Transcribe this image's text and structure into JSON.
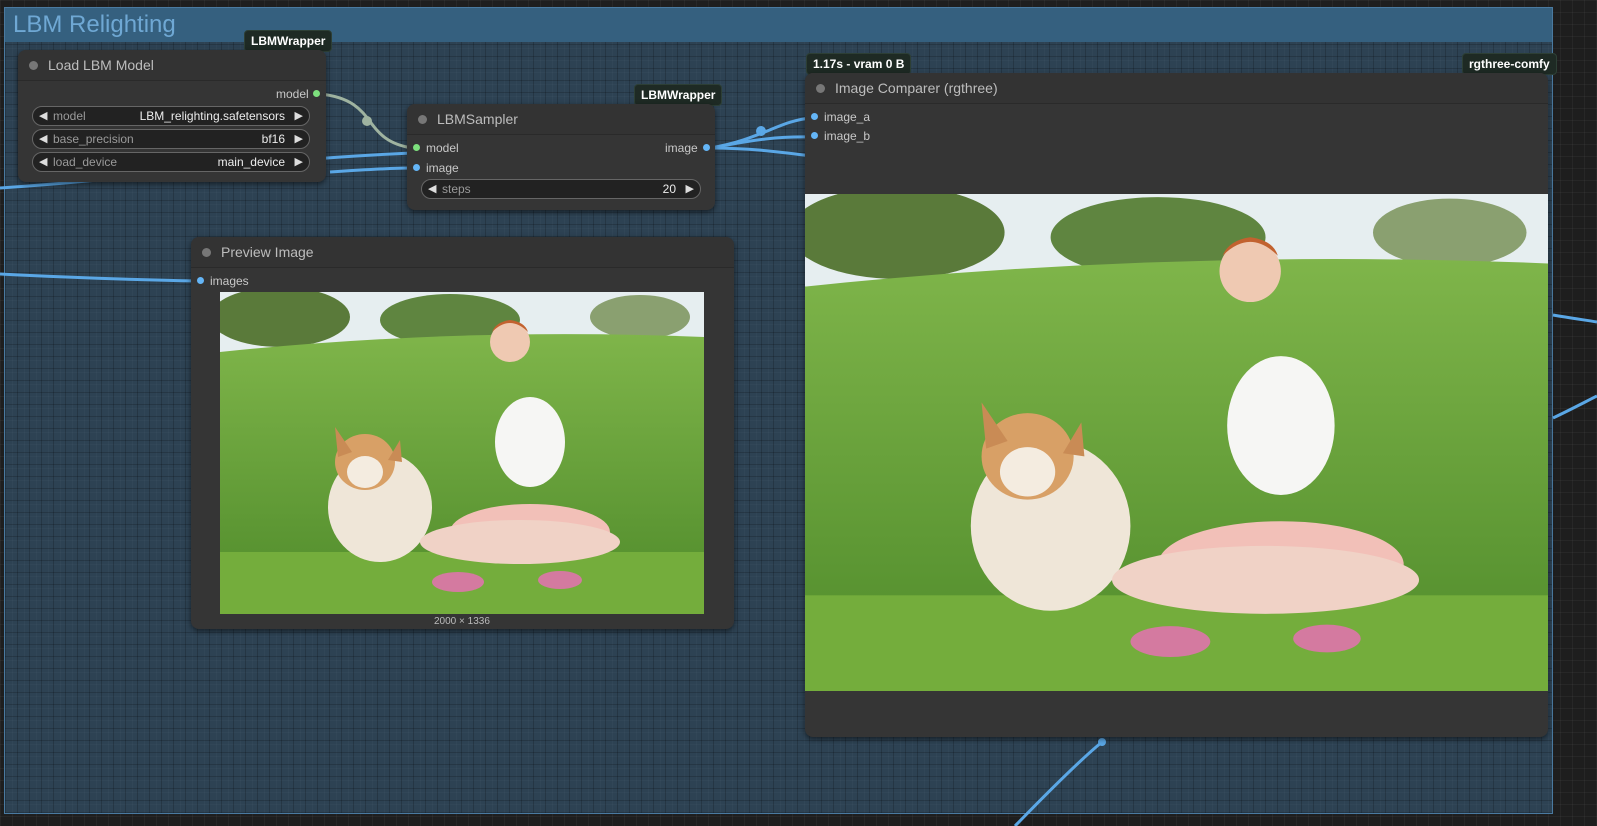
{
  "group": {
    "title": "LBM Relighting"
  },
  "badges": {
    "load_lbm": "LBMWrapper",
    "sampler": "LBMWrapper",
    "timing": "1.17s - vram 0 B",
    "comparer": "rgthree-comfy"
  },
  "load_lbm_node": {
    "title": "Load LBM Model",
    "output_label": "model",
    "widgets": [
      {
        "name": "model",
        "value": "LBM_relighting.safetensors"
      },
      {
        "name": "base_precision",
        "value": "bf16"
      },
      {
        "name": "load_device",
        "value": "main_device"
      }
    ]
  },
  "sampler_node": {
    "title": "LBMSampler",
    "inputs": [
      "model",
      "image"
    ],
    "output_label": "image",
    "widget": {
      "name": "steps",
      "value": "20"
    }
  },
  "preview_node": {
    "title": "Preview Image",
    "input_label": "images",
    "caption": "2000 × 1336"
  },
  "comparer_node": {
    "title": "Image Comparer (rgthree)",
    "inputs": [
      "image_a",
      "image_b"
    ]
  },
  "colors": {
    "model_socket": "#7de07d",
    "image_socket": "#64b5f6",
    "wire_image": "#5aa7e6",
    "wire_model": "#9fb3a0"
  }
}
